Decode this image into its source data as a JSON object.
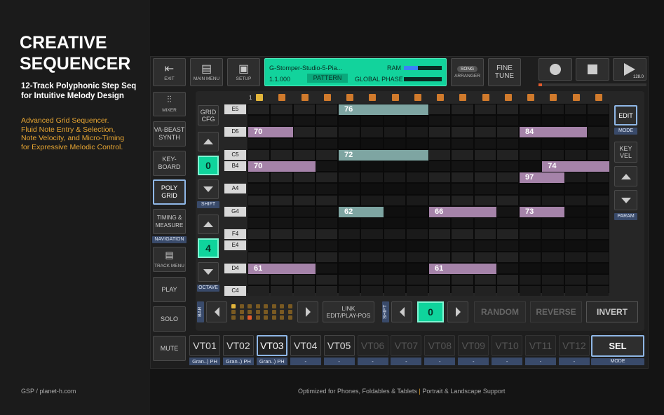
{
  "promo": {
    "title_line1": "CREATIVE",
    "title_line2": "SEQUENCER",
    "subtitle_line1": "12-Track Polyphonic Step Seq",
    "subtitle_line2": "for Intuitive Melody Design",
    "desc_line1": "Advanced Grid Sequencer.",
    "desc_line2": "Fluid Note Entry & Selection,",
    "desc_line3": "Note Velocity, and Micro-Timing",
    "desc_line4": "for Expressive Melodic Control."
  },
  "footer": {
    "left": "GSP / planet-h.com",
    "center_a": "Optimized for Phones, Foldables & Tablets",
    "center_sep": "|",
    "center_b": "Portrait & Landscape Support"
  },
  "toolbar": {
    "exit": "EXIT",
    "main_menu": "MAIN MENU",
    "setup": "SETUP",
    "song": "SONG",
    "arranger": "ARRANGER",
    "fine_tune_1": "FINE",
    "fine_tune_2": "TUNE",
    "tempo": "128.0"
  },
  "display": {
    "project": "G-Stomper-Studio-5-Pia...",
    "position": "1.1.000",
    "pattern": "PATTERN",
    "ram": "RAM",
    "global_phase": "GLOBAL PHASE",
    "ram_fraction": 0.37
  },
  "left_nav": {
    "mixer": "MIXER",
    "va_beast_1": "VA-BEAST",
    "va_beast_2": "SYNTH",
    "keyboard_1": "KEY-",
    "keyboard_2": "BOARD",
    "poly_grid_1": "POLY",
    "poly_grid_2": "GRID",
    "timing_1": "TIMING &",
    "timing_2": "MEASURE",
    "navigation": "NAVIGATION",
    "track_menu": "TRACK MENU",
    "play": "PLAY",
    "solo": "SOLO",
    "mute": "MUTE"
  },
  "grid_controls": {
    "grid_cfg_1": "GRID",
    "grid_cfg_2": "CFG",
    "shift_value": "0",
    "shift": "SHIFT",
    "octave_value": "4",
    "octave": "OCTAVE"
  },
  "right_controls": {
    "edit": "EDIT",
    "mode": "MODE",
    "key_vel_1": "KEY",
    "key_vel_2": "VEL",
    "param": "PARAM"
  },
  "bottom_bar": {
    "bar": "BAR",
    "link_1": "LINK",
    "link_2": "EDIT/PLAY-POS",
    "shift": "SHIFT",
    "shift_value": "0",
    "random": "RANDOM",
    "reverse": "REVERSE",
    "invert": "INVERT"
  },
  "step_header": {
    "first_label": "1"
  },
  "row_labels": [
    "E5",
    "D5",
    "C5",
    "B4",
    "A4",
    "G4",
    "F4",
    "E4",
    "D4",
    "C4"
  ],
  "notes": [
    {
      "label": "76",
      "color": "teal"
    },
    {
      "label": "70",
      "color": "purple"
    },
    {
      "label": "84",
      "color": "purple"
    },
    {
      "label": "72",
      "color": "teal"
    },
    {
      "label": "70",
      "color": "purple"
    },
    {
      "label": "74",
      "color": "purple"
    },
    {
      "label": "97",
      "color": "purple"
    },
    {
      "label": "62",
      "color": "teal"
    },
    {
      "label": "66",
      "color": "purple"
    },
    {
      "label": "73",
      "color": "purple"
    },
    {
      "label": "61",
      "color": "purple"
    },
    {
      "label": "61",
      "color": "purple"
    }
  ],
  "tracks": [
    {
      "label": "VT01",
      "sub": "Gran..) PH"
    },
    {
      "label": "VT02",
      "sub": "Gran..) PH"
    },
    {
      "label": "VT03",
      "sub": "Gran..) PH"
    },
    {
      "label": "VT04",
      "sub": "-"
    },
    {
      "label": "VT05",
      "sub": "-"
    },
    {
      "label": "VT06",
      "sub": "-"
    },
    {
      "label": "VT07",
      "sub": "-"
    },
    {
      "label": "VT08",
      "sub": "-"
    },
    {
      "label": "VT09",
      "sub": "-"
    },
    {
      "label": "VT10",
      "sub": "-"
    },
    {
      "label": "VT11",
      "sub": "-"
    },
    {
      "label": "VT12",
      "sub": "-"
    }
  ],
  "sel": {
    "label": "SEL",
    "mode": "MODE"
  },
  "colors": {
    "accent": "#0fd49c",
    "note_purple": "#a583a9",
    "note_teal": "#7ea5a2",
    "selection": "#8fb7e6",
    "label_bg": "#394a6a"
  }
}
